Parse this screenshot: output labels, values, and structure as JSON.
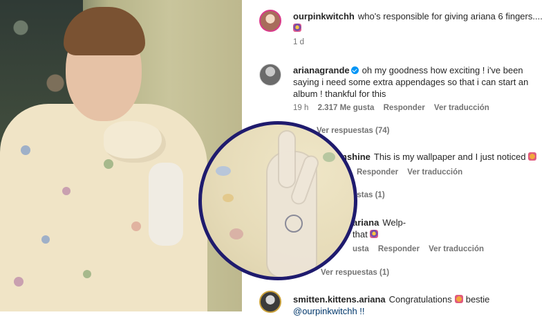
{
  "comments": [
    {
      "username": "ourpinkwitchh",
      "text": "who's responsible for giving ariana 6 fingers....",
      "time": "1 d"
    },
    {
      "username": "arianagrande",
      "verified": true,
      "text": "oh my goodness how exciting ! i've been saying i need some extra appendages so that i can start an album ! thankful for this",
      "time": "19 h",
      "likes": "2.317 Me gusta",
      "reply_label": "Responder",
      "translate_label": "Ver traducción",
      "view_replies": "Ver respuestas (74)"
    },
    {
      "username_fragment": "nshine",
      "text": "This is my wallpaper and I just noticed",
      "reply_label": "Responder",
      "translate_label": "Ver traducción",
      "view_replies_fragment": "estas (1)"
    },
    {
      "username_fragment": "ariana",
      "text_line1": "Welp-",
      "text_line2_fragment": "that",
      "likes_fragment": "usta",
      "reply_label": "Responder",
      "translate_label": "Ver traducción",
      "view_replies": "Ver respuestas (1)"
    },
    {
      "username": "smitten.kittens.ariana",
      "text": "Congratulations",
      "text_after_emoji": "bestie",
      "mention": "@ourpinkwitchh !!"
    }
  ],
  "colors": {
    "zoom_ring": "#1f1b6e",
    "verified": "#0095f6",
    "meta_text": "#737373",
    "mention": "#00376b"
  },
  "icons": [
    "verified-badge-icon",
    "emoji-icon"
  ]
}
